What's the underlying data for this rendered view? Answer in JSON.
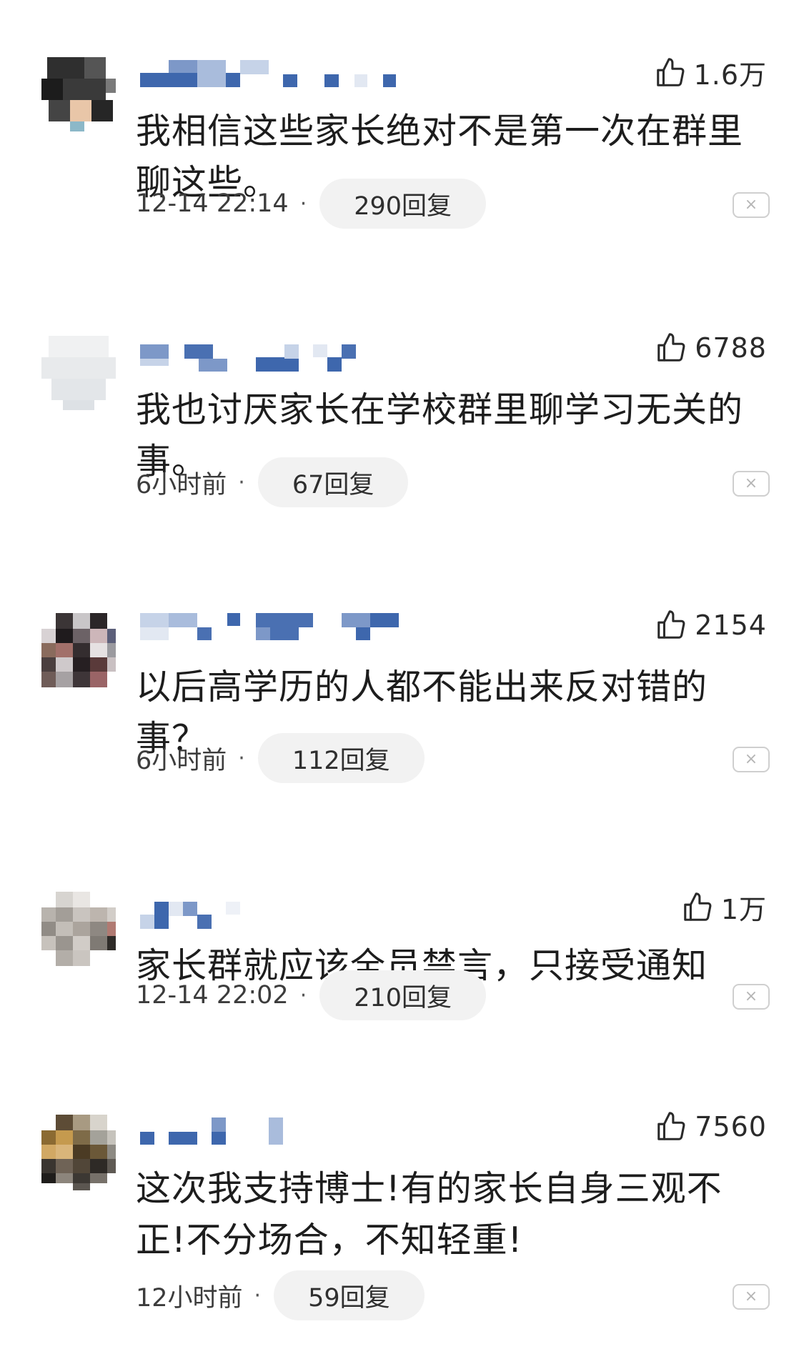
{
  "comments": [
    {
      "likes": "1.6万",
      "text": "我相信这些家长绝对不是第一次在群里聊这些。",
      "time": "12-14 22:14",
      "replies": "290回复",
      "close_icon": "close-icon"
    },
    {
      "likes": "6788",
      "text": "我也讨厌家长在学校群里聊学习无关的事。",
      "time": "6小时前",
      "replies": "67回复",
      "close_icon": "close-icon"
    },
    {
      "likes": "2154",
      "text": "以后高学历的人都不能出来反对错的事？",
      "time": "6小时前",
      "replies": "112回复",
      "close_icon": "close-icon"
    },
    {
      "likes": "1万",
      "text": "家长群就应该全员禁言，只接受通知",
      "time": "12-14 22:02",
      "replies": "210回复",
      "close_icon": "close-icon"
    },
    {
      "likes": "7560",
      "text": "这次我支持博士!有的家长自身三观不正!不分场合，不知轻重!",
      "time": "12小时前",
      "replies": "59回复",
      "close_icon": "close-icon"
    }
  ],
  "labels": {
    "dot": "·",
    "close": "×"
  }
}
